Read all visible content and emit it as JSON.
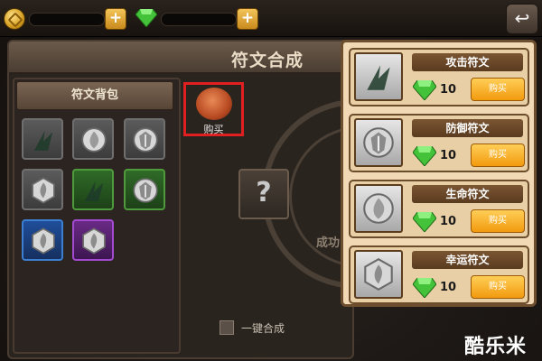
{
  "top_bar": {
    "coin_icon": "gold-coin-icon",
    "gem_icon": "green-gem-icon",
    "back_icon": "return-arrow-icon",
    "back_glyph": "↩",
    "add_glyph": "+"
  },
  "main": {
    "title": "符文合成",
    "inventory_title": "符文背包",
    "unknown_glyph": "?",
    "success_label": "成功",
    "one_click_label": "一键合成"
  },
  "featured_item": {
    "label": "购买"
  },
  "inventory": [
    {
      "color": "grey",
      "icon": "attack-rune-icon"
    },
    {
      "color": "grey",
      "icon": "life-rune-icon"
    },
    {
      "color": "grey",
      "icon": "defense-rune-icon"
    },
    {
      "color": "grey",
      "icon": "luck-rune-icon"
    },
    {
      "color": "green",
      "icon": "attack-rune-icon"
    },
    {
      "color": "green",
      "icon": "defense-rune-icon"
    },
    {
      "color": "blue",
      "icon": "luck-rune-icon"
    },
    {
      "color": "purple",
      "icon": "luck-rune-icon"
    }
  ],
  "shop": {
    "items": [
      {
        "name": "攻击符文",
        "price": "10",
        "buy_label": "购买",
        "icon": "attack-rune-icon"
      },
      {
        "name": "防御符文",
        "price": "10",
        "buy_label": "购买",
        "icon": "defense-rune-icon"
      },
      {
        "name": "生命符文",
        "price": "10",
        "buy_label": "购买",
        "icon": "life-rune-icon"
      },
      {
        "name": "幸运符文",
        "price": "10",
        "buy_label": "购买",
        "icon": "luck-rune-icon"
      }
    ]
  },
  "watermark": "酷乐米"
}
